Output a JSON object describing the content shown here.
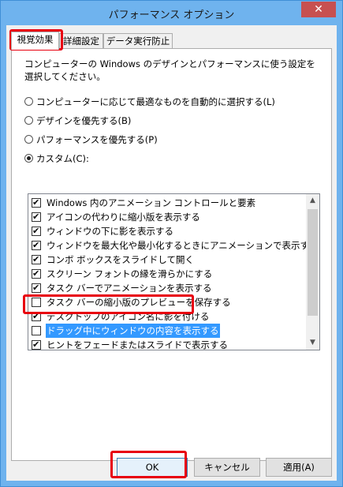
{
  "window": {
    "title": "パフォーマンス オプション",
    "close_glyph": "✕"
  },
  "tabs": [
    {
      "label": "視覚効果",
      "active": true
    },
    {
      "label": "詳細設定",
      "active": false
    },
    {
      "label": "データ実行防止",
      "active": false
    }
  ],
  "description": "コンピューターの Windows のデザインとパフォーマンスに使う設定を選択してください。",
  "radios": [
    {
      "label": "コンピューターに応じて最適なものを自動的に選択する(L)",
      "checked": false
    },
    {
      "label": "デザインを優先する(B)",
      "checked": false
    },
    {
      "label": "パフォーマンスを優先する(P)",
      "checked": false
    },
    {
      "label": "カスタム(C):",
      "checked": true
    }
  ],
  "effects": [
    {
      "label": "Windows 内のアニメーション コントロールと要素",
      "checked": true
    },
    {
      "label": "アイコンの代わりに縮小版を表示する",
      "checked": true
    },
    {
      "label": "ウィンドウの下に影を表示する",
      "checked": true
    },
    {
      "label": "ウィンドウを最大化や最小化するときにアニメーションで表示する",
      "checked": true
    },
    {
      "label": "コンボ ボックスをスライドして開く",
      "checked": true
    },
    {
      "label": "スクリーン フォントの縁を滑らかにする",
      "checked": true
    },
    {
      "label": "タスク バーでアニメーションを表示する",
      "checked": true
    },
    {
      "label": "タスク バーの縮小版のプレビューを保存する",
      "checked": false
    },
    {
      "label": "デスクトップのアイコン名に影を付ける",
      "checked": true
    },
    {
      "label": "ドラッグ中にウィンドウの内容を表示する",
      "checked": false,
      "selected": true
    },
    {
      "label": "ヒントをフェードまたはスライドで表示する",
      "checked": true
    }
  ],
  "buttons": {
    "ok": "OK",
    "cancel": "キャンセル",
    "apply": "適用(A)"
  },
  "colors": {
    "title_bar": "#6fb3ee",
    "close_button": "#c75050",
    "highlight": "#e8000f",
    "selection": "#3399ff"
  }
}
